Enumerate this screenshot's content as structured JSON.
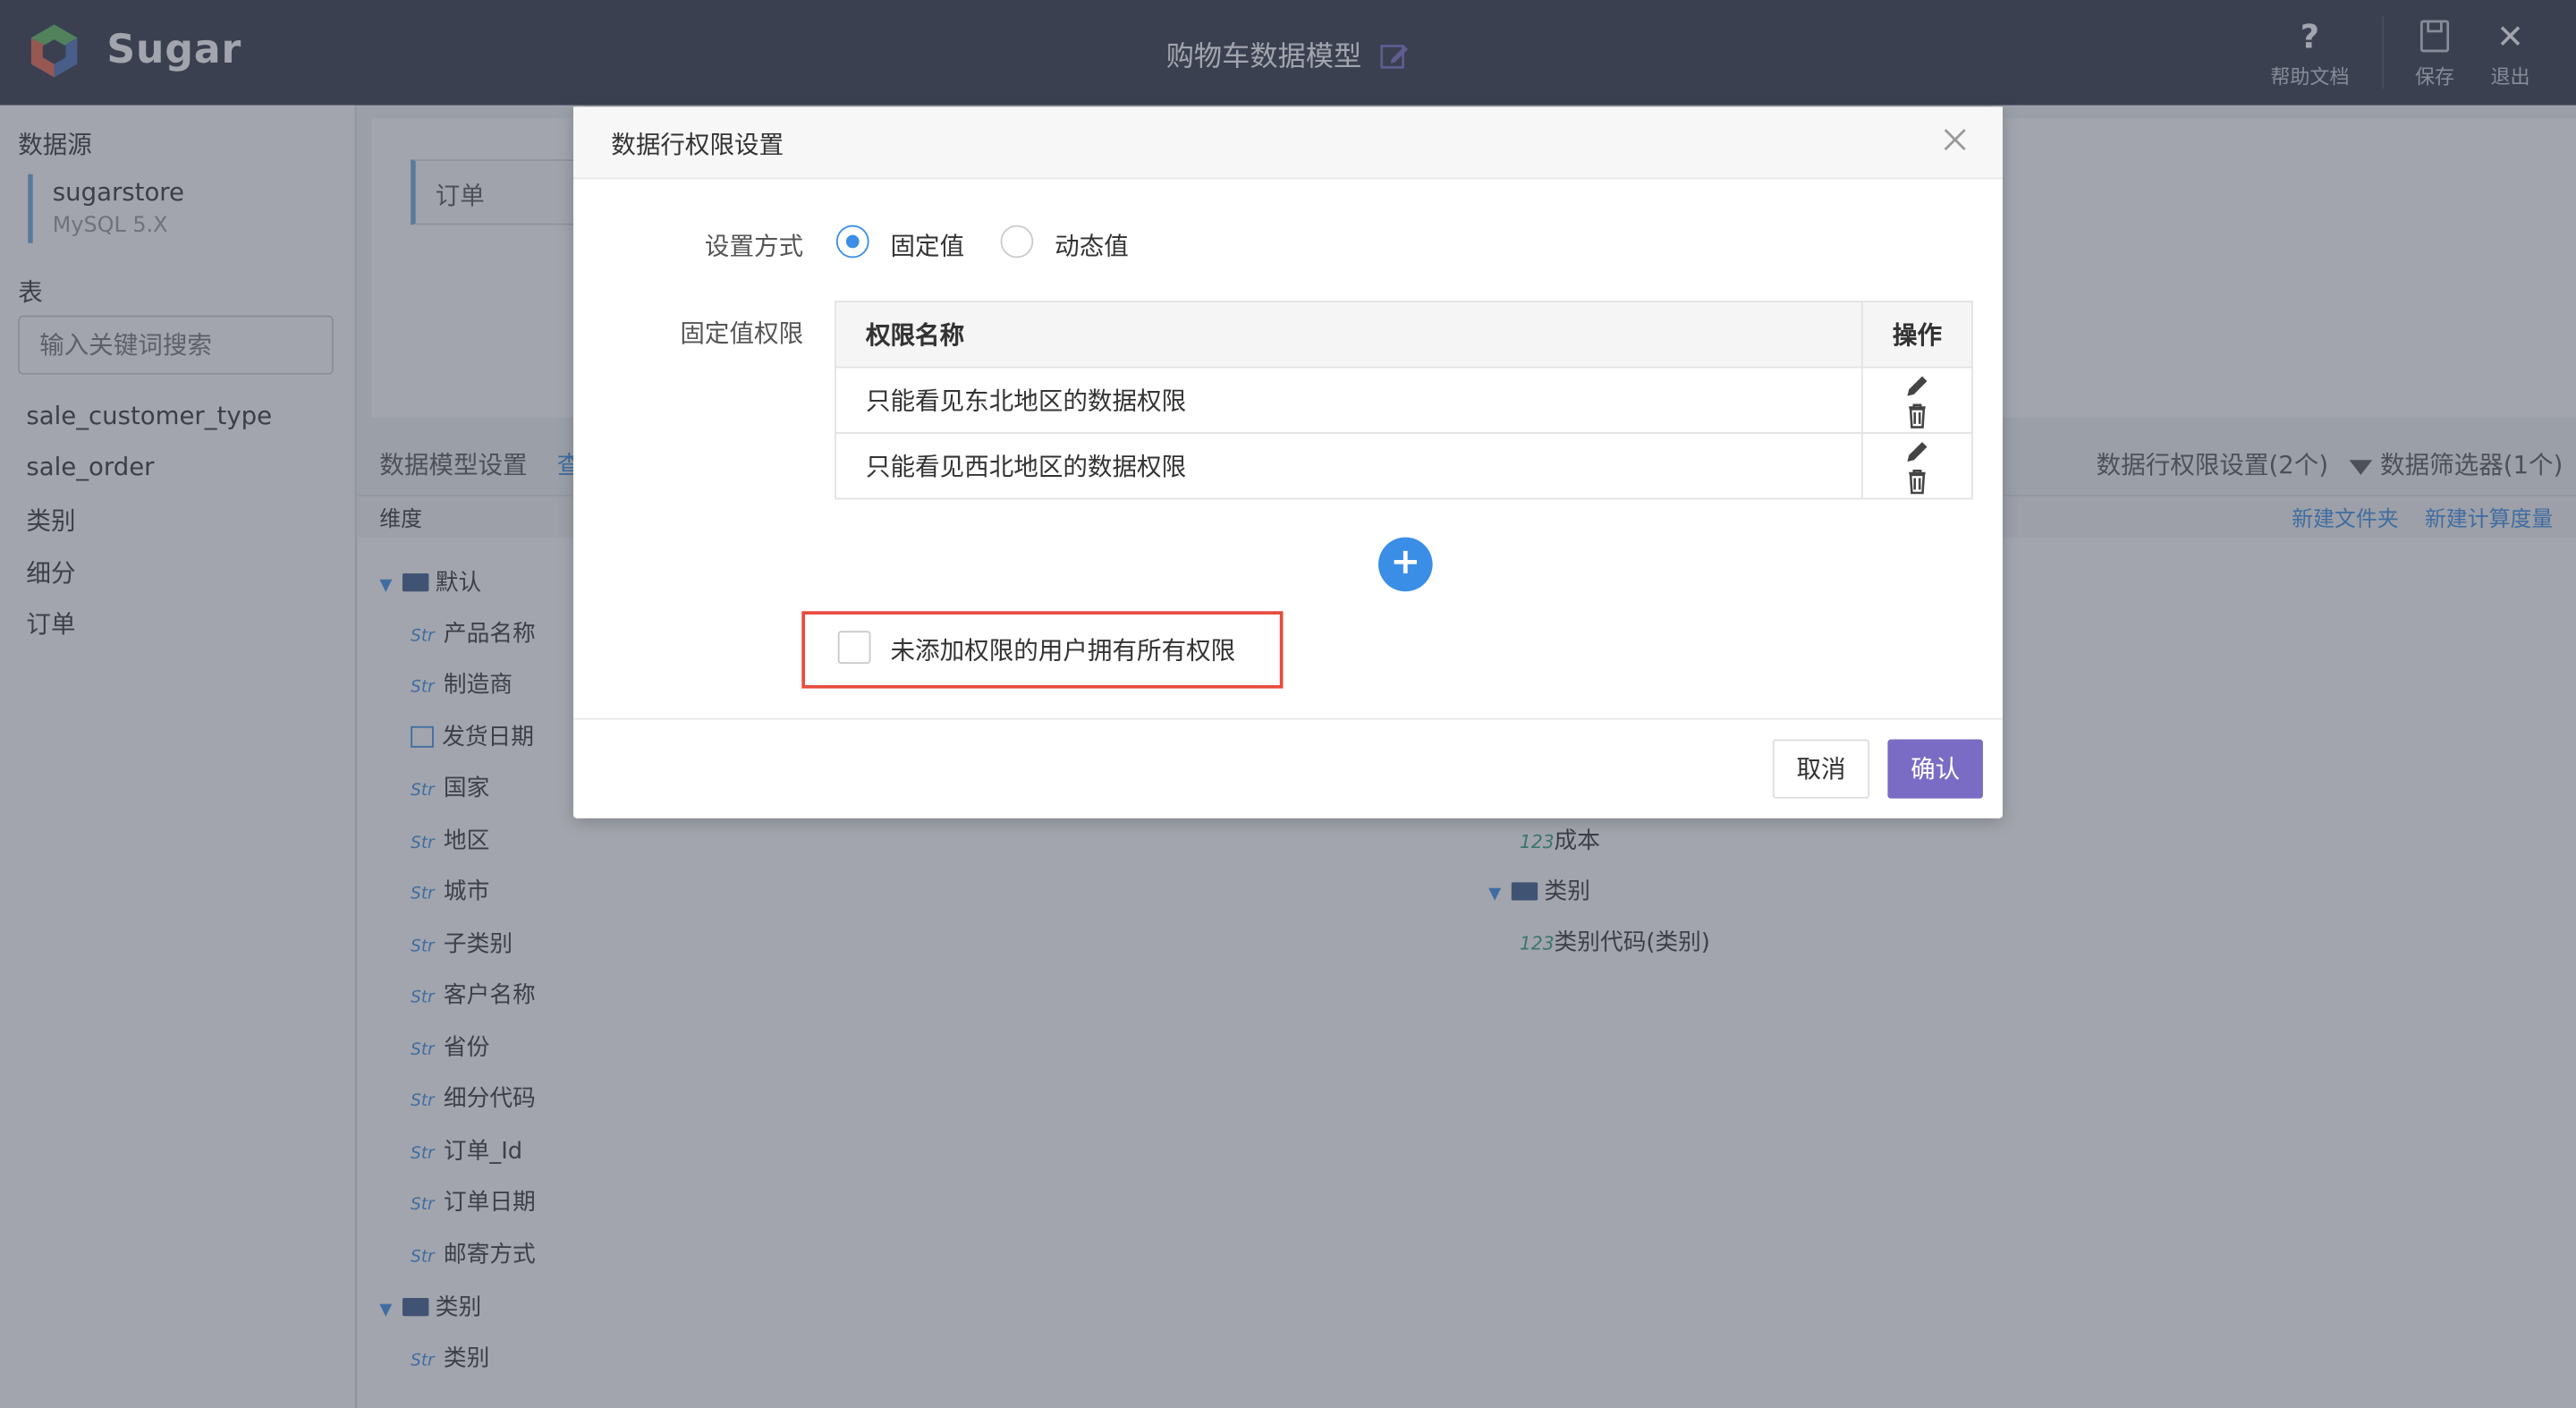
{
  "app": {
    "brand": "Sugar",
    "page_title": "购物车数据模型"
  },
  "topbar": {
    "help": "帮助文档",
    "save": "保存",
    "exit": "退出"
  },
  "sidebar": {
    "datasource_heading": "数据源",
    "datasource_name": "sugarstore",
    "datasource_version": "MySQL 5.X",
    "table_heading": "表",
    "search_placeholder": "输入关键词搜索",
    "tables": [
      "sale_customer_type",
      "sale_order",
      "类别",
      "细分",
      "订单"
    ]
  },
  "main": {
    "active_table": "订单",
    "model_settings_label": "数据模型设置",
    "model_settings_link": "查",
    "row_permission_summary": "数据行权限设置(2个)",
    "filter_summary": "数据筛选器(1个)",
    "dimension_label": "维度",
    "new_folder": "新建文件夹",
    "new_measure": "新建计算度量",
    "dimensions": {
      "group_default": "默认",
      "fields": [
        {
          "type": "Str",
          "name": "产品名称"
        },
        {
          "type": "Str",
          "name": "制造商"
        },
        {
          "type": "date",
          "name": "发货日期"
        },
        {
          "type": "Str",
          "name": "国家"
        },
        {
          "type": "Str",
          "name": "地区"
        },
        {
          "type": "Str",
          "name": "城市"
        },
        {
          "type": "Str",
          "name": "子类别"
        },
        {
          "type": "Str",
          "name": "客户名称"
        },
        {
          "type": "Str",
          "name": "省份"
        },
        {
          "type": "Str",
          "name": "细分代码"
        },
        {
          "type": "Str",
          "name": "订单_Id"
        },
        {
          "type": "Str",
          "name": "订单日期"
        },
        {
          "type": "Str",
          "name": "邮寄方式"
        }
      ],
      "group_category": "类别",
      "category_fields": [
        {
          "type": "Str",
          "name": "类别"
        }
      ]
    },
    "measures": {
      "fields_top": [
        {
          "type": "123",
          "name": "成本"
        }
      ],
      "group_category": "类别",
      "category_fields": [
        {
          "type": "123",
          "name": "类别代码(类别)"
        }
      ]
    }
  },
  "modal": {
    "title": "数据行权限设置",
    "setting_mode_label": "设置方式",
    "option_fixed": "固定值",
    "option_dynamic": "动态值",
    "selected_option": "固定值",
    "fixed_permission_label": "固定值权限",
    "table_headers": {
      "name": "权限名称",
      "action": "操作"
    },
    "permissions": [
      {
        "name": "只能看见东北地区的数据权限"
      },
      {
        "name": "只能看见西北地区的数据权限"
      }
    ],
    "add_symbol": "+",
    "checkbox_label": "未添加权限的用户拥有所有权限",
    "checkbox_checked": false,
    "cancel": "取消",
    "confirm": "确认"
  },
  "colors": {
    "topbar": "#2f3445",
    "accent_blue": "#3a8ee6",
    "confirm_purple": "#7a6cc4",
    "highlight_red": "#e74c3c"
  }
}
